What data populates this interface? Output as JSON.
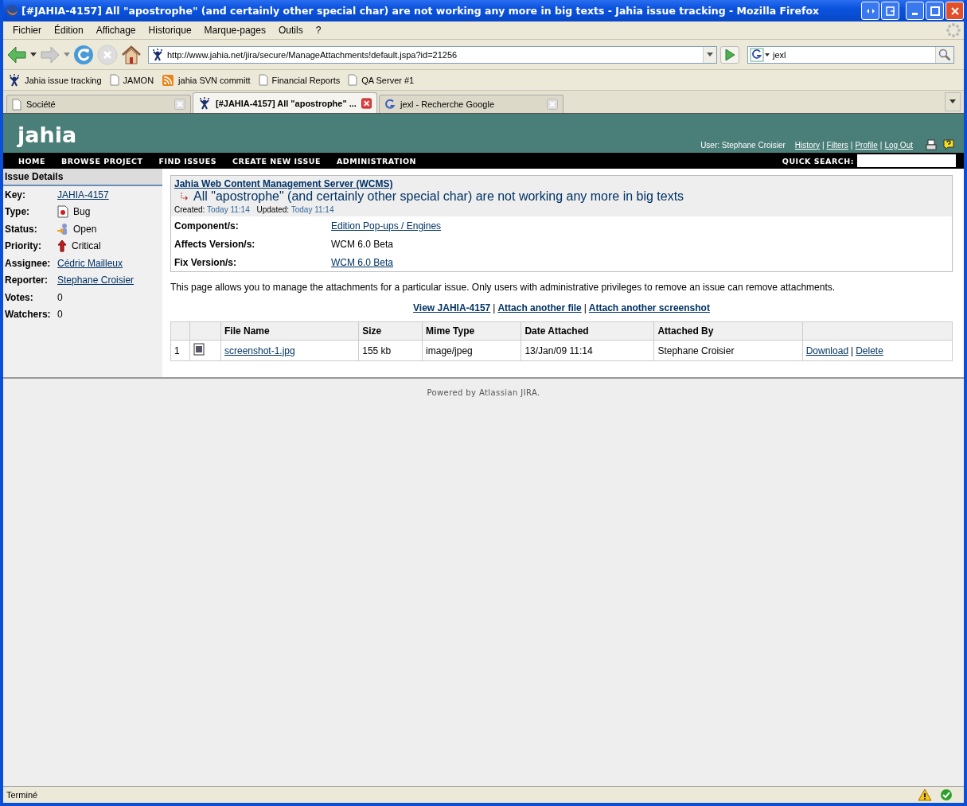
{
  "window": {
    "title": "[#JAHIA-4157] All \"apostrophe\" (and certainly other special char) are not working any more in big texts - Jahia issue tracking - Mozilla Firefox"
  },
  "menu": [
    "Fichier",
    "Édition",
    "Affichage",
    "Historique",
    "Marque-pages",
    "Outils",
    "?"
  ],
  "toolbar": {
    "url": "http://www.jahia.net/jira/secure/ManageAttachments!default.jspa?id=21256",
    "search": "jexl"
  },
  "bookmarks": [
    {
      "label": "Jahia issue tracking",
      "kind": "jahia"
    },
    {
      "label": "JAMON",
      "kind": "page"
    },
    {
      "label": "jahia SVN committ",
      "kind": "feed"
    },
    {
      "label": "Financial Reports",
      "kind": "page"
    },
    {
      "label": "QA Server #1",
      "kind": "page"
    }
  ],
  "tabs": [
    {
      "label": "Société",
      "kind": "page",
      "selected": false
    },
    {
      "label": "[#JAHIA-4157] All \"apostrophe\" ...",
      "kind": "jahia",
      "selected": true
    },
    {
      "label": "jexl - Recherche Google",
      "kind": "google",
      "selected": false
    }
  ],
  "header": {
    "logo": "jahia",
    "user": "User: Stephane Croisier",
    "links": [
      "History",
      "Filters",
      "Profile",
      "Log Out"
    ],
    "separator": "|"
  },
  "nav": {
    "items": [
      "HOME",
      "BROWSE PROJECT",
      "FIND ISSUES",
      "CREATE NEW ISSUE",
      "ADMINISTRATION"
    ],
    "quick_search": "QUICK SEARCH:"
  },
  "sidebar": {
    "heading": "Issue Details",
    "fields": [
      {
        "label": "Key:",
        "value": "JAHIA-4157",
        "kind": "link"
      },
      {
        "label": "Type:",
        "value": "Bug",
        "kind": "type"
      },
      {
        "label": "Status:",
        "value": "Open",
        "kind": "status"
      },
      {
        "label": "Priority:",
        "value": "Critical",
        "kind": "priority"
      },
      {
        "label": "Assignee:",
        "value": "Cédric Mailleux",
        "kind": "link"
      },
      {
        "label": "Reporter:",
        "value": "Stephane Croisier",
        "kind": "link"
      },
      {
        "label": "Votes:",
        "value": "0",
        "kind": "text"
      },
      {
        "label": "Watchers:",
        "value": "0",
        "kind": "text"
      }
    ]
  },
  "issue": {
    "project": "Jahia Web Content Management Server (WCMS)",
    "title": "All \"apostrophe\" (and certainly other special char) are not working any more in big texts",
    "created_label": "Created:",
    "created": "Today 11:14",
    "updated_label": "Updated:",
    "updated": "Today 11:14",
    "fields": [
      {
        "label": "Component/s:",
        "value": "Edition Pop-ups / Engines",
        "kind": "link"
      },
      {
        "label": "Affects Version/s:",
        "value": "WCM 6.0 Beta",
        "kind": "text"
      },
      {
        "label": "Fix Version/s:",
        "value": "WCM 6.0 Beta",
        "kind": "link"
      }
    ]
  },
  "description": "This page allows you to manage the attachments for a particular issue. Only users with administrative privileges to remove an issue can remove attachments.",
  "actions": {
    "links": [
      "View JAHIA-4157",
      "Attach another file",
      "Attach another screenshot"
    ],
    "separator": "|"
  },
  "table": {
    "columns": [
      "File Name",
      "Size",
      "Mime Type",
      "Date Attached",
      "Attached By"
    ],
    "rows": [
      {
        "index": "1",
        "file": "screenshot-1.jpg",
        "size": "155 kb",
        "mime": "image/jpeg",
        "date": "13/Jan/09 11:14",
        "by": "Stephane Croisier",
        "actions": [
          "Download",
          "Delete"
        ],
        "separator": "|"
      }
    ]
  },
  "footer": "Powered by Atlassian JIRA.",
  "status_bar": "Terminé"
}
